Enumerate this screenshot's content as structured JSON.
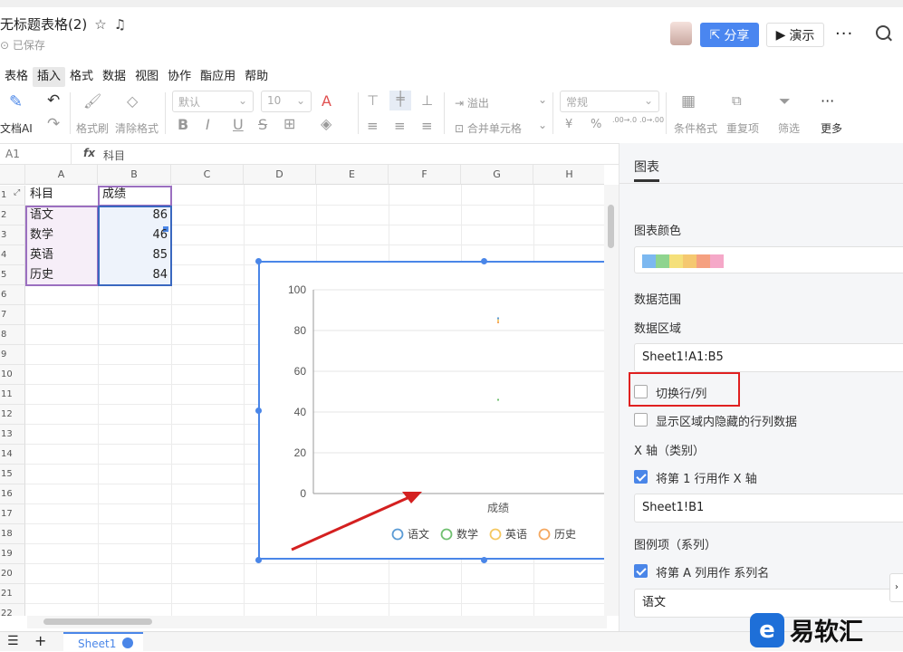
{
  "header": {
    "title": "无标题表格(2)",
    "saved": "已保存",
    "share_label": "分享",
    "present_label": "演示",
    "more": "···"
  },
  "menu": [
    "表格",
    "插入",
    "格式",
    "数据",
    "视图",
    "协作",
    "酯应用",
    "帮助"
  ],
  "menu_active": "插入",
  "toolbar": {
    "ai": "文档AI",
    "format_painter": "格式刷",
    "clear_format": "清除格式",
    "font": "默认",
    "size": "10",
    "overflow": "溢出",
    "merge": "合并单元格",
    "numfmt": "常规",
    "cond": "条件格式",
    "dup": "重复项",
    "filter": "筛选",
    "more": "更多",
    "bold": "B",
    "italic": "I",
    "under": "U",
    "strike": "S",
    "font_color": "A",
    "yen": "¥",
    "pct": "%",
    "dec1": ".00→.0",
    "dec2": ".0→.00"
  },
  "formula": {
    "cell_ref": "A1",
    "fx": "fx",
    "value": "科目"
  },
  "columns": [
    "A",
    "B",
    "C",
    "D",
    "E",
    "F",
    "G",
    "H"
  ],
  "rows": [
    "1",
    "2",
    "3",
    "4",
    "5",
    "6",
    "7",
    "8",
    "9",
    "10",
    "11",
    "12",
    "13",
    "14",
    "15",
    "16",
    "17",
    "18",
    "19",
    "20",
    "21",
    "22"
  ],
  "cells": {
    "a1": "科目",
    "b1": "成绩",
    "a2": "语文",
    "b2": "86",
    "a3": "数学",
    "b3": "46",
    "a4": "英语",
    "b4": "85",
    "a5": "历史",
    "b5": "84"
  },
  "chart_data": {
    "type": "scatter",
    "categories": [
      "成绩"
    ],
    "series": [
      {
        "name": "语文",
        "values": [
          86
        ]
      },
      {
        "name": "数学",
        "values": [
          46
        ]
      },
      {
        "name": "英语",
        "values": [
          85
        ]
      },
      {
        "name": "历史",
        "values": [
          84
        ]
      }
    ],
    "xlabel": "成绩",
    "ylim": [
      0,
      100
    ],
    "yticks": [
      "0",
      "20",
      "40",
      "60",
      "80",
      "100"
    ],
    "legend": "bottom",
    "colors": [
      "#5b9bd5",
      "#70c070",
      "#f5c860",
      "#f5a860"
    ]
  },
  "panel": {
    "tab": "图表",
    "color_label": "图表颜色",
    "colors": [
      "#7cb8f0",
      "#8fd48f",
      "#f5e07a",
      "#f5c870",
      "#f5a080",
      "#f5a8c8"
    ],
    "range_label": "数据范围",
    "area_label": "数据区域",
    "area_value": "Sheet1!A1:B5",
    "switch_label": "切换行/列",
    "hidden_label": "显示区域内隐藏的行列数据",
    "x_label": "X 轴（类别）",
    "x_check": "将第 1 行用作 X 轴",
    "x_value": "Sheet1!B1",
    "legend_label": "图例项（系列）",
    "legend_check": "将第 A 列用作 系列名",
    "legend_value": "语文"
  },
  "sheet": {
    "tab": "Sheet1",
    "plus": "+",
    "list": "☰"
  },
  "watermark": {
    "text": "易软汇"
  }
}
